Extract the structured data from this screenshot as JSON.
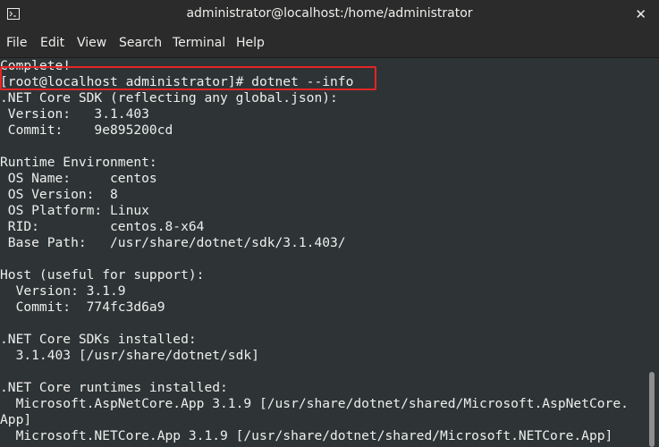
{
  "window": {
    "title": "administrator@localhost:/home/administrator",
    "close_glyph": "✕",
    "icon": "terminal-icon"
  },
  "menu": [
    "File",
    "Edit",
    "View",
    "Search",
    "Terminal",
    "Help"
  ],
  "terminal": {
    "lines": [
      "Complete!",
      "[root@localhost administrator]# dotnet --info",
      ".NET Core SDK (reflecting any global.json):",
      " Version:   3.1.403",
      " Commit:    9e895200cd",
      "",
      "Runtime Environment:",
      " OS Name:     centos",
      " OS Version:  8",
      " OS Platform: Linux",
      " RID:         centos.8-x64",
      " Base Path:   /usr/share/dotnet/sdk/3.1.403/",
      "",
      "Host (useful for support):",
      "  Version: 3.1.9",
      "  Commit:  774fc3d6a9",
      "",
      ".NET Core SDKs installed:",
      "  3.1.403 [/usr/share/dotnet/sdk]",
      "",
      ".NET Core runtimes installed:",
      "  Microsoft.AspNetCore.App 3.1.9 [/usr/share/dotnet/shared/Microsoft.AspNetCore.",
      "App]",
      "  Microsoft.NETCore.App 3.1.9 [/usr/share/dotnet/shared/Microsoft.NETCore.App]"
    ],
    "highlighted_line_index": 1
  },
  "colors": {
    "background": "#2e3436",
    "text": "#eeeeec",
    "titlebar": "#2b2b2b",
    "highlight": "#e52526"
  }
}
